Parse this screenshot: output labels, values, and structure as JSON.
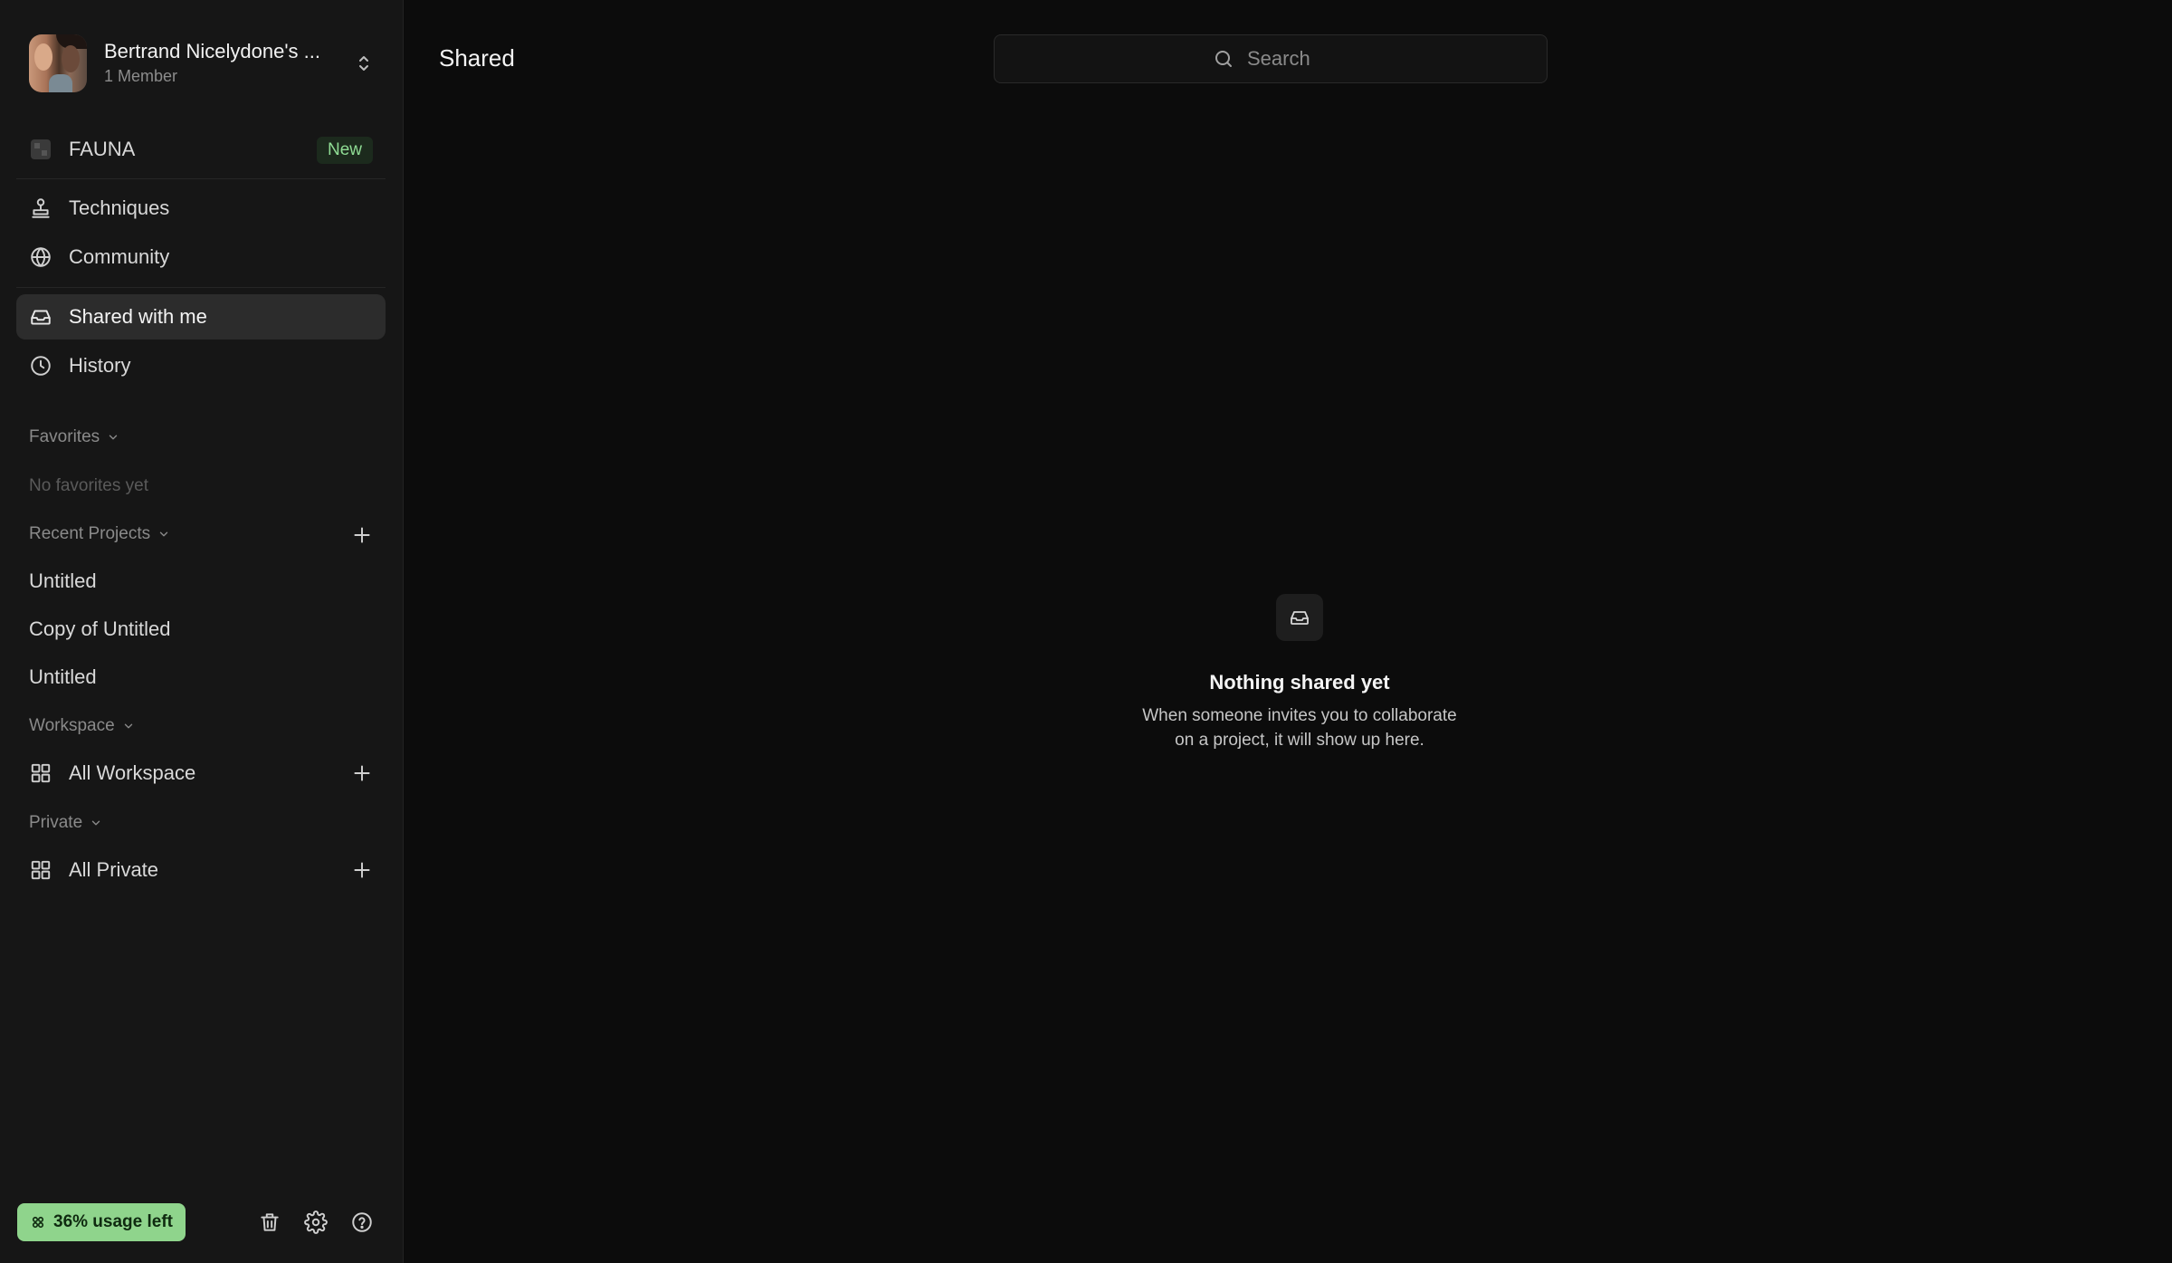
{
  "account": {
    "name": "Bertrand Nicelydone's ...",
    "members": "1 Member"
  },
  "nav": {
    "fauna": {
      "label": "FAUNA",
      "badge": "New"
    },
    "techniques": "Techniques",
    "community": "Community",
    "shared_with_me": "Shared with me",
    "history": "History"
  },
  "favorites": {
    "label": "Favorites",
    "empty": "No favorites yet"
  },
  "recent_projects": {
    "label": "Recent Projects",
    "items": [
      "Untitled",
      "Copy of Untitled",
      "Untitled"
    ]
  },
  "workspace": {
    "label": "Workspace",
    "all": "All Workspace"
  },
  "private": {
    "label": "Private",
    "all": "All Private"
  },
  "footer": {
    "usage": "36% usage left",
    "accent_color": "#8fd48c"
  },
  "main": {
    "title": "Shared",
    "search_placeholder": "Search",
    "empty_title": "Nothing shared yet",
    "empty_desc_line1": "When someone invites you to collaborate",
    "empty_desc_line2": "on a project, it will show up here."
  }
}
